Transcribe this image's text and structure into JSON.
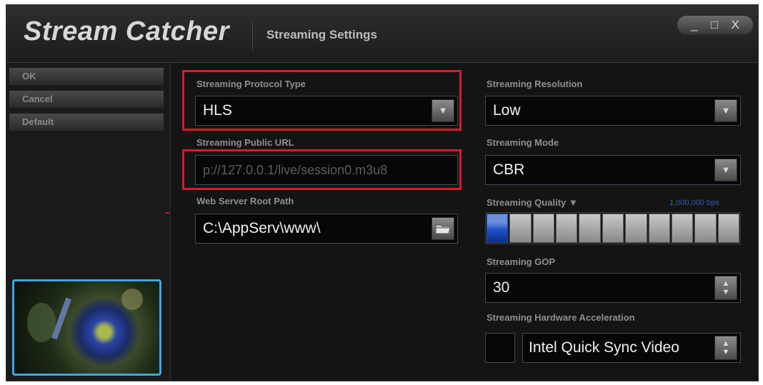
{
  "window": {
    "app_title": "Stream Catcher",
    "subtitle": "Streaming Settings",
    "controls": {
      "minimize": "_",
      "maximize": "□",
      "close": "X"
    }
  },
  "sidebar": {
    "buttons": [
      {
        "label": "OK"
      },
      {
        "label": "Cancel"
      },
      {
        "label": "Default"
      }
    ],
    "preview": {
      "description": "video preview thumbnail",
      "border_color": "#3ca6e6"
    }
  },
  "left_panel": {
    "protocol": {
      "label": "Streaming Protocol Type",
      "value": "HLS"
    },
    "public_url": {
      "label": "Streaming Public URL",
      "value": "p://127.0.0.1/live/session0.m3u8"
    },
    "web_root": {
      "label": "Web Server Root Path",
      "value": "C:\\AppServ\\www\\"
    }
  },
  "right_panel": {
    "resolution": {
      "label": "Streaming Resolution",
      "value": "Low"
    },
    "mode": {
      "label": "Streaming Mode",
      "value": "CBR"
    },
    "quality": {
      "label": "Streaming Quality ▼",
      "value_text": "1,000,000 bps",
      "level_segments": 1,
      "total_segments": 11
    },
    "gop": {
      "label": "Streaming GOP",
      "value": "30"
    },
    "hw_accel": {
      "label": "Streaming Hardware Acceleration",
      "value": "Intel Quick Sync Video"
    }
  },
  "icons": {
    "dropdown": "▼",
    "spin_up": "▲",
    "spin_down": "▼",
    "folder": "folder-icon"
  },
  "colors": {
    "highlight": "#d11e2c",
    "quality_fill": "#1f52c8",
    "accent_blue": "#3ca6e6"
  }
}
